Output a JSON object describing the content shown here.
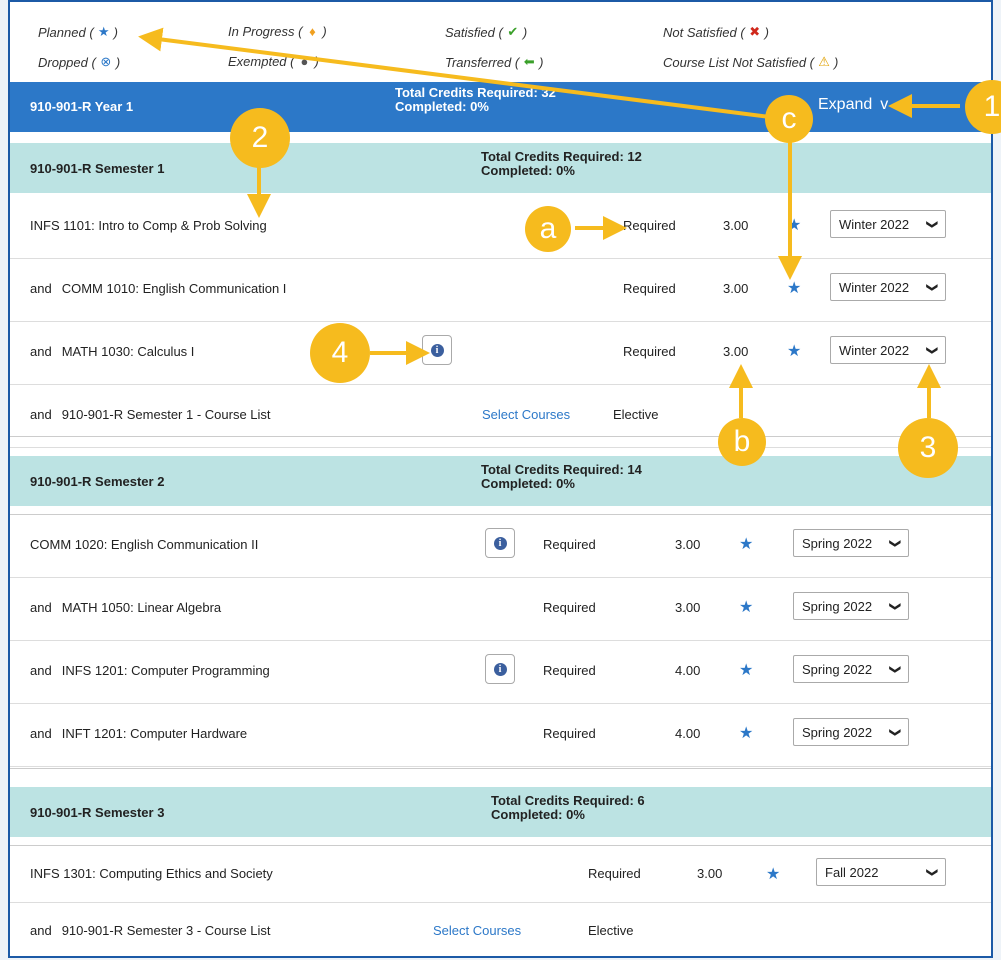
{
  "legend": [
    {
      "label": "Planned (",
      "icon": "star-icon",
      "glyph": "★",
      "color": "#2c78c8"
    },
    {
      "label": "In Progress (",
      "icon": "diamond-icon",
      "glyph": "♦",
      "color": "#f0a020"
    },
    {
      "label": "Satisfied (",
      "icon": "check-icon",
      "glyph": "✔",
      "color": "#3aa02a"
    },
    {
      "label": "Not Satisfied (",
      "icon": "x-icon",
      "glyph": "✖",
      "color": "#d0281c"
    },
    {
      "label": "Dropped (",
      "icon": "circle-x-icon",
      "glyph": "⊗",
      "color": "#2c78c8"
    },
    {
      "label": "Exempted (",
      "icon": "circle-icon",
      "glyph": "●",
      "color": "#555"
    },
    {
      "label": "Transferred (",
      "icon": "arrow-left-icon",
      "glyph": "⬅",
      "color": "#3aa02a"
    },
    {
      "label": "Course List Not Satisfied (",
      "icon": "warning-icon",
      "glyph": "⚠",
      "color": "#e0a000"
    }
  ],
  "legend_close": ")",
  "year": {
    "name": "910-901-R Year 1",
    "credits": "Total Credits Required: 32",
    "completed": "Completed: 0%",
    "expand": "Expand",
    "expand_icon": "v"
  },
  "semesters": [
    {
      "name": "910-901-R Semester 1",
      "credits": "Total Credits Required: 12",
      "completed": "Completed: 0%"
    },
    {
      "name": "910-901-R Semester 2",
      "credits": "Total Credits Required: 14",
      "completed": "Completed: 0%"
    },
    {
      "name": "910-901-R Semester 3",
      "credits": "Total Credits Required: 6",
      "completed": "Completed: 0%"
    }
  ],
  "rows": [
    {
      "and": "",
      "course": "INFS 1101: Intro to Comp & Prob Solving",
      "status": "Required",
      "credits": "3.00",
      "term": "Winter 2022"
    },
    {
      "and": "and",
      "course": "COMM 1010: English Communication I",
      "status": "Required",
      "credits": "3.00",
      "term": "Winter 2022"
    },
    {
      "and": "and",
      "course": "MATH 1030: Calculus I",
      "status": "Required",
      "credits": "3.00",
      "term": "Winter 2022"
    },
    {
      "and": "and",
      "course": "910-901-R Semester 1 - Course List",
      "link": "Select Courses",
      "status": "Elective"
    },
    {
      "and": "",
      "course": "COMM 1020: English Communication II",
      "status": "Required",
      "credits": "3.00",
      "term": "Spring 2022"
    },
    {
      "and": "and",
      "course": "MATH 1050: Linear Algebra",
      "status": "Required",
      "credits": "3.00",
      "term": "Spring 2022"
    },
    {
      "and": "and",
      "course": "INFS 1201: Computer Programming",
      "status": "Required",
      "credits": "4.00",
      "term": "Spring 2022"
    },
    {
      "and": "and",
      "course": "INFT 1201: Computer Hardware",
      "status": "Required",
      "credits": "4.00",
      "term": "Spring 2022"
    },
    {
      "and": "",
      "course": "INFS 1301: Computing Ethics and Society",
      "status": "Required",
      "credits": "3.00",
      "term": "Fall 2022"
    },
    {
      "and": "and",
      "course": "910-901-R Semester 3 - Course List",
      "link": "Select Courses",
      "status": "Elective"
    }
  ],
  "info_glyph": "i",
  "star_glyph": "★",
  "chevron_glyph": "❯",
  "callouts": [
    "1",
    "2",
    "3",
    "4",
    "a",
    "b",
    "c"
  ],
  "colors": {
    "accent": "#2c78c8",
    "semester": "#bce3e3",
    "callout": "#f6bb1e"
  }
}
